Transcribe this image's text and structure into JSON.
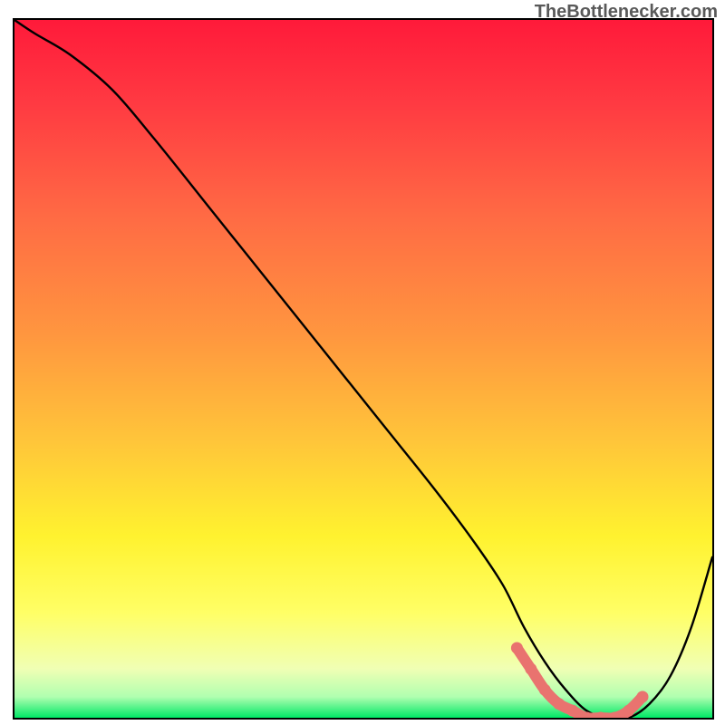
{
  "watermark": "TheBottlenecker.com",
  "colors": {
    "black_curve": "#000000",
    "pink_curve": "#e9736f",
    "gradient_stops": [
      {
        "offset": "0%",
        "color": "#ff1a3a"
      },
      {
        "offset": "12%",
        "color": "#ff3a42"
      },
      {
        "offset": "28%",
        "color": "#ff6a44"
      },
      {
        "offset": "45%",
        "color": "#ff963f"
      },
      {
        "offset": "60%",
        "color": "#ffc43a"
      },
      {
        "offset": "74%",
        "color": "#fff22f"
      },
      {
        "offset": "85%",
        "color": "#ffff66"
      },
      {
        "offset": "93%",
        "color": "#f0ffb4"
      },
      {
        "offset": "97%",
        "color": "#b0ffb0"
      },
      {
        "offset": "100%",
        "color": "#00e866"
      }
    ]
  },
  "chart_data": {
    "type": "line",
    "title": "",
    "xlabel": "",
    "ylabel": "",
    "xlim": [
      0,
      100
    ],
    "ylim": [
      0,
      100
    ],
    "note": "x maps left→right across plot, y is percentage height from bottom (0) to top (100). Values estimated visually.",
    "series": [
      {
        "name": "black_curve",
        "x": [
          0,
          3,
          8,
          14,
          20,
          28,
          36,
          44,
          52,
          60,
          66,
          70,
          73,
          76,
          79,
          82,
          85,
          88,
          91,
          94,
          97,
          100
        ],
        "y": [
          100,
          98,
          95,
          90,
          83,
          73,
          63,
          53,
          43,
          33,
          25,
          19,
          13,
          8,
          4,
          1,
          0,
          0,
          2,
          6,
          13,
          23
        ]
      },
      {
        "name": "pink_highlight",
        "x": [
          72,
          74,
          76,
          78,
          80,
          82,
          84,
          86,
          88,
          90
        ],
        "y": [
          10,
          7,
          4,
          2,
          1,
          0,
          0,
          0,
          1,
          3
        ]
      }
    ]
  }
}
